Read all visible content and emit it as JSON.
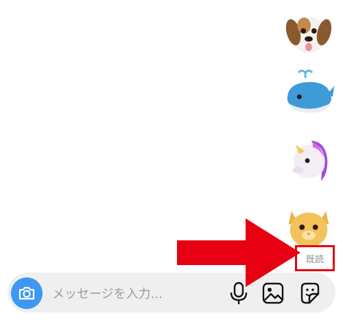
{
  "messages": [
    {
      "type": "animoji",
      "icon": "dog-animoji-icon"
    },
    {
      "type": "animoji",
      "icon": "whale-animoji-icon"
    },
    {
      "type": "animoji",
      "icon": "unicorn-animoji-icon"
    },
    {
      "type": "animoji",
      "icon": "cat-animoji-icon"
    }
  ],
  "read_receipt": {
    "label": "既読"
  },
  "annotation": {
    "arrow_color": "#e60012",
    "box_color": "#e60012"
  },
  "composer": {
    "placeholder": "メッセージを入力...",
    "camera_icon": "camera-icon",
    "mic_icon": "microphone-icon",
    "gallery_icon": "gallery-icon",
    "sticker_icon": "sticker-icon",
    "accent": "#3e97f1"
  }
}
